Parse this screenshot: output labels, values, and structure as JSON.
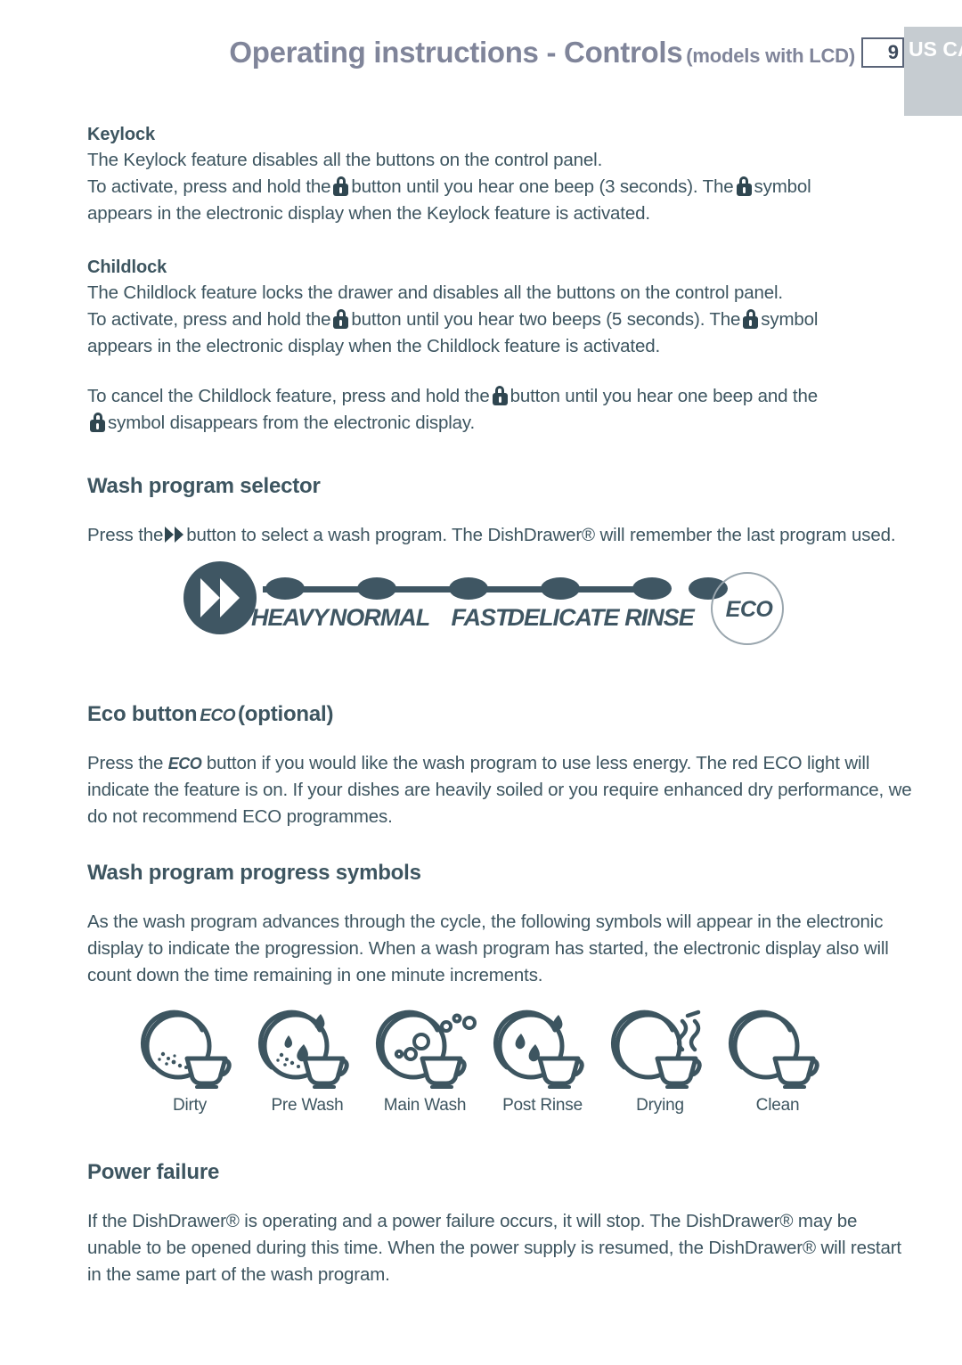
{
  "header": {
    "title": "Operating instructions - Controls",
    "subtitle": "(models with LCD)",
    "page_number": "9",
    "region_tab": "US CA",
    "title_color": "#80859a",
    "tab_color": "#c6ccd1"
  },
  "body_color": "#3d5560",
  "icon_color": "#3f5663",
  "sections": {
    "keylock": {
      "heading": "Keylock",
      "line1": "The Keylock feature disables all the buttons on the control panel.",
      "line2_a": "To activate, press and hold the",
      "line2_b": "button until you hear one beep (3 seconds).  The",
      "line2_c": "symbol",
      "line3": "appears in the electronic display when the Keylock feature is activated."
    },
    "childlock": {
      "heading": "Childlock",
      "line1": "The Childlock feature locks the drawer and disables all the buttons on the control panel.",
      "line2_a": "To activate, press and hold the",
      "line2_b": "button until you hear two beeps (5 seconds).  The",
      "line2_c": "symbol",
      "line3": "appears in the electronic display when the Childlock feature is activated.",
      "cancel_a": "To cancel the Childlock feature, press and hold the",
      "cancel_b": "button until you hear one beep and the",
      "cancel_c": "symbol disappears from the electronic display."
    },
    "wash_program_selector": {
      "heading": "Wash program selector",
      "para_a": "Press the",
      "para_b": "button to select a wash program.  The DishDrawer® will remember the last program used."
    },
    "eco_button": {
      "heading_a": "Eco button",
      "heading_eco": "ECO",
      "heading_b": "(optional)",
      "para_a": "Press the",
      "para_eco": "ECO",
      "para_b": "button if you would like the wash program to use less energy.  The red ECO light will indicate the feature is on.  If your dishes are heavily soiled or you require enhanced dry performance, we do not recommend ECO programmes."
    },
    "progress_symbols": {
      "heading": "Wash program progress symbols",
      "para": "As the wash program advances through the cycle, the following symbols will appear in the electronic display to indicate the progression. When a wash program has started, the electronic display also will count down the time remaining in one minute increments."
    },
    "power_failure": {
      "heading": "Power failure",
      "para": "If the DishDrawer® is operating and a power failure occurs, it will stop. The DishDrawer® may be unable to be opened during this time. When the power supply is resumed, the DishDrawer® will restart in the same part of the wash program."
    }
  },
  "selector_graphic": {
    "button_icon": "fast-forward-icon",
    "programs": [
      "HEAVY",
      "NORMAL",
      "FAST",
      "DELICATE",
      "RINSE"
    ],
    "eco_label": "ECO"
  },
  "progress_items": [
    {
      "label": "Dirty",
      "icon": "dirty-dish-icon"
    },
    {
      "label": "Pre Wash",
      "icon": "pre-wash-icon"
    },
    {
      "label": "Main Wash",
      "icon": "main-wash-icon"
    },
    {
      "label": "Post Rinse",
      "icon": "post-rinse-icon"
    },
    {
      "label": "Drying",
      "icon": "drying-icon"
    },
    {
      "label": "Clean",
      "icon": "clean-dish-icon"
    }
  ]
}
